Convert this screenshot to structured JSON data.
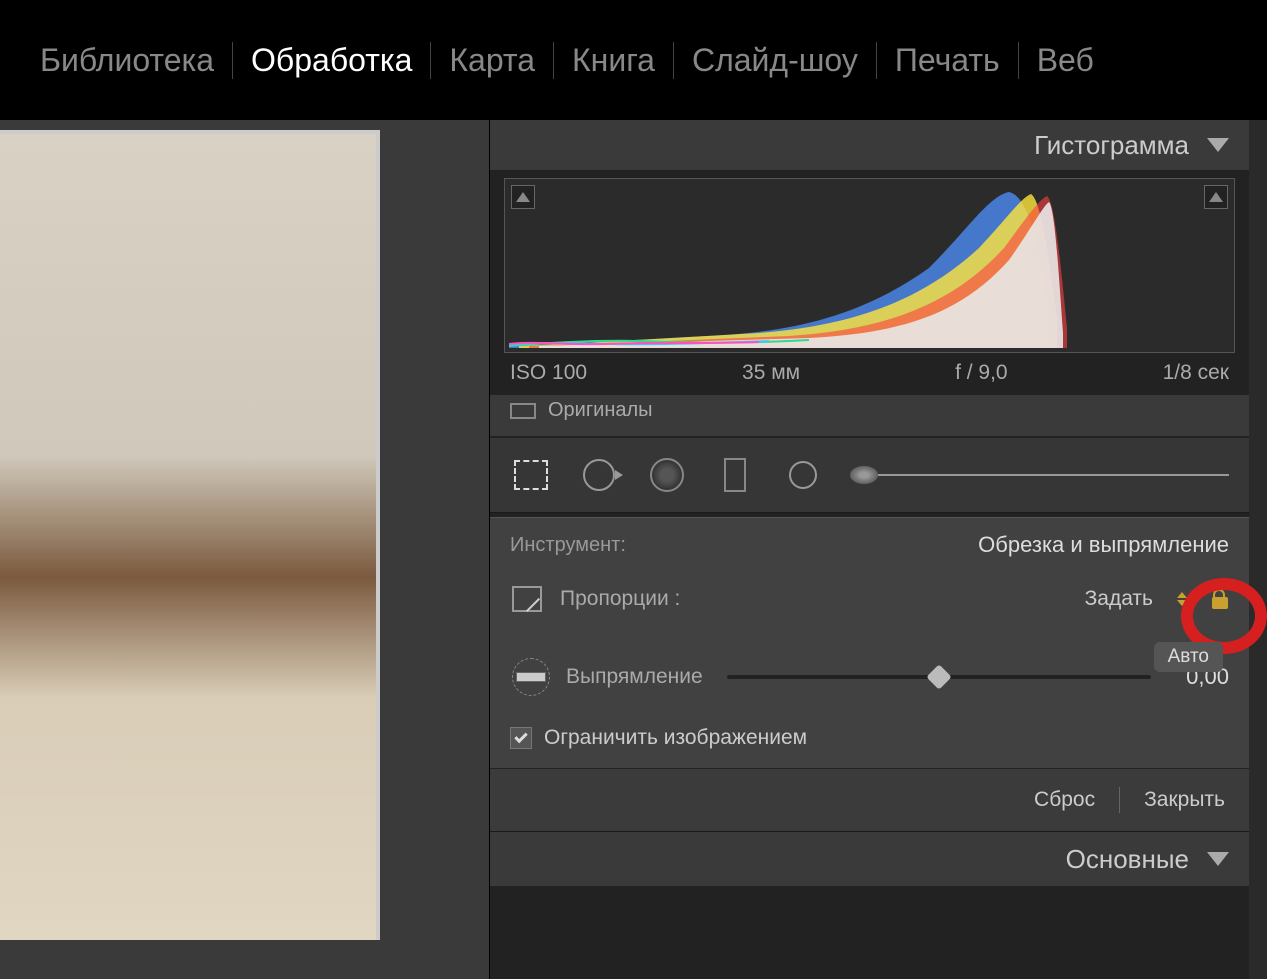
{
  "nav": {
    "tabs": [
      {
        "label": "Библиотека",
        "active": false
      },
      {
        "label": "Обработка",
        "active": true
      },
      {
        "label": "Карта",
        "active": false
      },
      {
        "label": "Книга",
        "active": false
      },
      {
        "label": "Слайд-шоу",
        "active": false
      },
      {
        "label": "Печать",
        "active": false
      },
      {
        "label": "Веб",
        "active": false
      }
    ]
  },
  "histogram": {
    "title": "Гистограмма",
    "meta": {
      "iso": "ISO 100",
      "focal": "35 мм",
      "aperture": "f / 9,0",
      "shutter": "1/8 сек"
    },
    "originals_label": "Оригиналы"
  },
  "tool_strip": {
    "tools": [
      "crop",
      "spot",
      "redeye",
      "graduated",
      "radial",
      "brush"
    ]
  },
  "crop_panel": {
    "instrument_label": "Инструмент:",
    "instrument_name": "Обрезка и выпрямление",
    "aspect": {
      "label": "Пропорции :",
      "value": "Задать",
      "locked": true
    },
    "straighten": {
      "label": "Выпрямление",
      "auto_label": "Авто",
      "value": "0,00",
      "slider_position": 0.5
    },
    "constrain": {
      "label": "Ограничить изображением",
      "checked": true
    },
    "footer": {
      "reset": "Сброс",
      "close": "Закрыть"
    }
  },
  "basic_panel": {
    "title": "Основные"
  },
  "annotation": {
    "red_circle_on_lock": true
  }
}
